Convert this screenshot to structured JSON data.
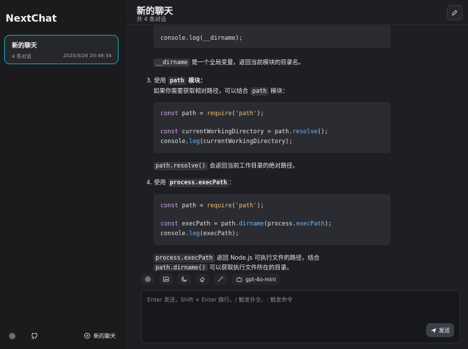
{
  "sidebar": {
    "app_title": "NextChat",
    "session": {
      "title": "新的聊天",
      "count": "4 条对话",
      "time": "2025/3/26 20:49:34"
    },
    "settings_icon": "settings-icon",
    "github_icon": "github-icon",
    "new_chat_label": "新的聊天"
  },
  "header": {
    "title": "新的聊天",
    "subtitle": "共 4 条对话"
  },
  "message": {
    "code1_line": "console.log(__dirname);",
    "p1_code": "__dirname",
    "p1_text": " 是一个全局变量，返回当前模块的目录名。",
    "item3_prefix": "3. 使用 ",
    "item3_code": "path",
    "item3_suffix": " 模块：",
    "item3_desc_a": "如果你需要获取相对路径，可以结合 ",
    "item3_desc_code": "path",
    "item3_desc_b": " 模块：",
    "code2": {
      "l1_kw": "const",
      "l1_mid": " path = ",
      "l1_fn": "require",
      "l1_open": "(",
      "l1_str": "'path'",
      "l1_end": ");",
      "l2_kw": "const",
      "l2_mid": " currentWorkingDirectory = path.",
      "l2_fn": "resolve",
      "l2_end": "();",
      "l3_a": "console.",
      "l3_fn": "log",
      "l3_end": "(currentWorkingDirectory);"
    },
    "p2_code": "path.resolve()",
    "p2_text": " 会返回当前工作目录的绝对路径。",
    "item4_prefix": "4. 使用 ",
    "item4_code": "process.execPath",
    "item4_suffix": "：",
    "code3": {
      "l1_kw": "const",
      "l1_mid": " path = ",
      "l1_fn": "require",
      "l1_open": "(",
      "l1_str": "'path'",
      "l1_end": ");",
      "l2_kw": "const",
      "l2_mid": " execPath = path.",
      "l2_fn": "dirname",
      "l2_mid2": "(process.",
      "l2_fn2": "execPath",
      "l2_end": ");",
      "l3_a": "console.",
      "l3_fn": "log",
      "l3_end": "(execPath);"
    },
    "p3_code": "process.execPath",
    "p3_text": " 返回 Node.js 可执行文件的路径，结合",
    "p3b_code": "path.dirname()",
    "p3b_text": " 可以获取执行文件所在的目录。"
  },
  "toolbar": {
    "icons": [
      "settings-icon",
      "image-icon",
      "theme-icon",
      "clear-icon",
      "mask-icon",
      "robot-icon"
    ],
    "model": "gpt-4o-mini"
  },
  "input": {
    "placeholder": "Enter 发送，Shift + Enter 换行，/ 触发补全，: 触发命令",
    "send_label": "发送"
  }
}
